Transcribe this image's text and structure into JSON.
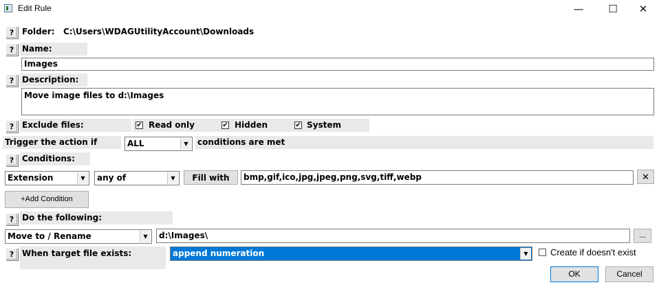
{
  "window": {
    "title": "Edit Rule",
    "minimize": "—",
    "maximize": "☐",
    "close": "✕"
  },
  "help_label": "?",
  "folder": {
    "label": "Folder:",
    "value": "C:\\Users\\WDAGUtilityAccount\\Downloads"
  },
  "name": {
    "label": "Name:",
    "value": "Images"
  },
  "description": {
    "label": "Description:",
    "value": "Move image files to d:\\Images"
  },
  "exclude": {
    "label": "Exclude files:",
    "options": [
      {
        "label": "Read only",
        "checked": true
      },
      {
        "label": "Hidden",
        "checked": true
      },
      {
        "label": "System",
        "checked": true
      }
    ],
    "check_mark": "✔"
  },
  "trigger": {
    "prefix": "Trigger the action if",
    "selected": "ALL",
    "suffix": "conditions are met"
  },
  "conditions": {
    "label": "Conditions:",
    "field": "Extension",
    "operator": "any of",
    "fill_label": "Fill with",
    "value": "bmp,gif,ico,jpg,jpeg,png,svg,tiff,webp",
    "remove_label": "✕",
    "add_label": "+Add Condition"
  },
  "action": {
    "label": "Do the following:",
    "selected": "Move to / Rename",
    "path": "d:\\Images\\",
    "browse_label": "...",
    "exists_label": "When target file exists:",
    "exists_selected": "append numeration",
    "create_label": "Create if doesn't exist"
  },
  "buttons": {
    "ok": "OK",
    "cancel": "Cancel"
  }
}
